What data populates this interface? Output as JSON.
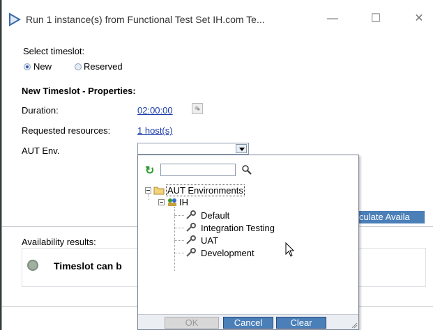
{
  "window": {
    "title": "Run 1 instance(s) from Functional Test Set IH.com Te...",
    "controls": {
      "minimize": "—",
      "maximize": "☐",
      "close": "✕"
    }
  },
  "timeslot": {
    "select_label": "Select timeslot:",
    "options": [
      {
        "label": "New",
        "selected": true
      },
      {
        "label": "Reserved",
        "selected": false
      }
    ]
  },
  "properties": {
    "heading": "New Timeslot - Properties:",
    "duration_label": "Duration:",
    "duration_value": "02:00:00",
    "resources_label": "Requested resources:",
    "resources_value": "1 host(s)",
    "aut_env_label": "AUT Env.",
    "aut_env_value": ""
  },
  "calculate_button": "culate Availa",
  "results": {
    "label": "Availability results:",
    "message": "Timeslot can b"
  },
  "popup": {
    "search_placeholder": "",
    "tree": {
      "root": "AUT Environments",
      "group": "IH",
      "items": [
        "Default",
        "Integration Testing",
        "UAT",
        "Development"
      ]
    },
    "buttons": {
      "ok": "OK",
      "cancel": "Cancel",
      "clear": "Clear"
    }
  },
  "icons": {
    "refresh": "refresh-icon",
    "search": "search-icon",
    "folder": "folder-icon",
    "group": "environment-group-icon",
    "item": "wrench-icon"
  },
  "colors": {
    "link": "#1a3aa8",
    "button_blue": "#4a7fb8",
    "refresh_green": "#2a9a2a",
    "backdrop": "#3a3a3a"
  }
}
